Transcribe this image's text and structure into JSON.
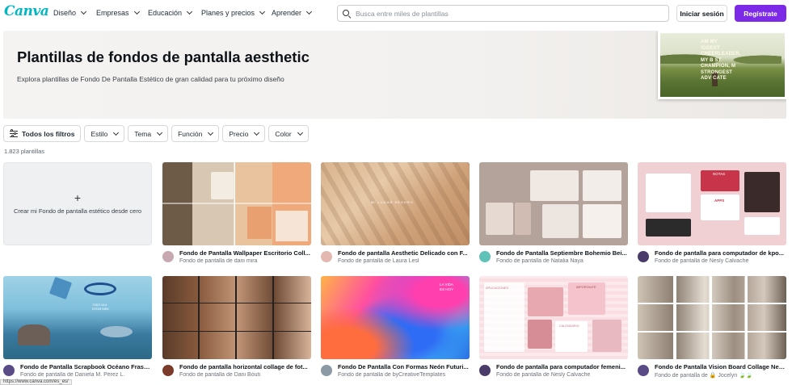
{
  "nav": {
    "logo": "Canva",
    "items": [
      "Diseño",
      "Empresas",
      "Educación",
      "Planes y precios",
      "Aprender"
    ],
    "search_placeholder": "Busca entre miles de plantillas",
    "login_label": "Iniciar sesión",
    "register_label": "Regístrate",
    "accent_color": "#7d2ae8"
  },
  "hero": {
    "title": "Plantillas de fondos de pantalla aesthetic",
    "subtitle": "Explora plantillas de Fondo De Pantalla Estético de gran calidad para tu próximo diseño",
    "image_text": "AM MY\nIGGEST\nCHEERLEADER,\nMY B ST\nCHAMPION, M\nSTRONGEST\nADV CATE"
  },
  "filters": {
    "all_label": "Todos los filtros",
    "chips": [
      "Estilo",
      "Tema",
      "Función",
      "Precio",
      "Color"
    ]
  },
  "results_count": "1.823 plantillas",
  "create_label": "Crear mi Fondo de pantalla estético desde cero",
  "cards": [
    {
      "title": "Fondo de Pantalla Wallpaper Escritorio Coll...",
      "author": "Fondo de pantalla de dani mira"
    },
    {
      "title": "Fondo de pantalla Aesthetic Delicado con F...",
      "author": "Fondo de pantalla de Laura Lesl"
    },
    {
      "title": "Fondo de Pantalla Septiembre Bohemio Bei...",
      "author": "Fondo de pantalla de Natalia Naya"
    },
    {
      "title": "Fondo de pantalla para computador de kpo...",
      "author": "Fondo de pantalla de Nesly Calvache"
    },
    {
      "title": "Fondo de Pantalla Scrapbook Océano Frase...",
      "author": "Fondo de pantalla de Daniela M. Pérez L."
    },
    {
      "title": "Fondo de pantalla horizontal collage de fot...",
      "author": "Fondo de pantalla de Dani Bóuti"
    },
    {
      "title": "Fondo De Pantalla Con Formas Neón Futuri...",
      "author": "Fondo de pantalla de byCreativeTemplates"
    },
    {
      "title": "Fondo de pantalla para computador femeni...",
      "author": "Fondo de pantalla de Nesly Calvache"
    },
    {
      "title": "Fondo de Pantalla Vision Board Collage Neu...",
      "author": "Fondo de pantalla de 🔒 Jocelyn 🍃🍃"
    }
  ],
  "thumb_texts": {
    "t2": "MI LUGAR SEGURO",
    "t4_top": "NOTAS",
    "t4_apps": "APPS",
    "t7": "LA VIDA\nES HOY",
    "t8_a": "APLICACIONES",
    "t8_b": "IMPORTANTE",
    "t8_c": "CALENDARIO",
    "t5": "TODO VA A\nESTAR BIEN"
  },
  "status_bar": "https://www.canva.com/es_es/"
}
